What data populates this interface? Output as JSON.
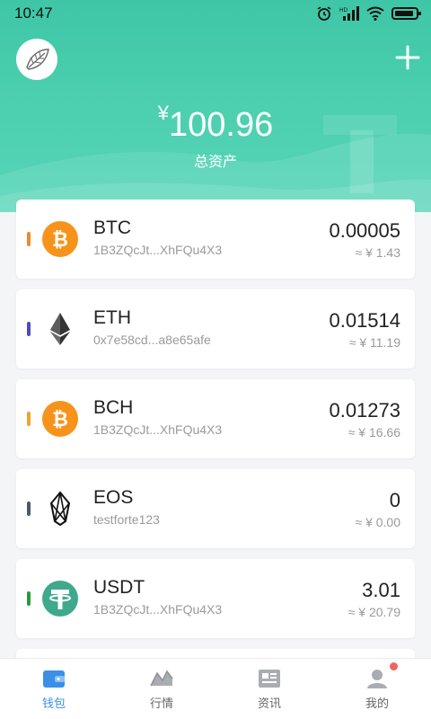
{
  "status_bar": {
    "time": "10:47",
    "battery_level": 0.9
  },
  "header": {
    "currency_symbol": "¥",
    "total_amount": "100.96",
    "total_label": "总资产",
    "accent_color": "#3ec6a6"
  },
  "wallets": [
    {
      "symbol": "BTC",
      "address": "1B3ZQcJt...XhFQu4X3",
      "balance": "0.00005",
      "fiat": "≈ ¥ 1.43",
      "marker_color": "#f08a2f",
      "icon": "bitcoin-icon"
    },
    {
      "symbol": "ETH",
      "address": "0x7e58cd...a8e65afe",
      "balance": "0.01514",
      "fiat": "≈ ¥ 11.19",
      "marker_color": "#4d4bb8",
      "icon": "ethereum-icon"
    },
    {
      "symbol": "BCH",
      "address": "1B3ZQcJt...XhFQu4X3",
      "balance": "0.01273",
      "fiat": "≈ ¥ 16.66",
      "marker_color": "#f0a22f",
      "icon": "bitcoin-cash-icon"
    },
    {
      "symbol": "EOS",
      "address": "testforte123",
      "balance": "0",
      "fiat": "≈ ¥ 0.00",
      "marker_color": "#4a5a6a",
      "icon": "eos-icon"
    },
    {
      "symbol": "USDT",
      "address": "1B3ZQcJt...XhFQu4X3",
      "balance": "3.01",
      "fiat": "≈ ¥ 20.79",
      "marker_color": "#2a9a3a",
      "icon": "tether-icon"
    }
  ],
  "bottom_nav": [
    {
      "label": "钱包",
      "icon": "wallet-icon",
      "active": true
    },
    {
      "label": "行情",
      "icon": "market-icon",
      "active": false
    },
    {
      "label": "资讯",
      "icon": "news-icon",
      "active": false
    },
    {
      "label": "我的",
      "icon": "profile-icon",
      "active": false,
      "badge": true
    }
  ]
}
